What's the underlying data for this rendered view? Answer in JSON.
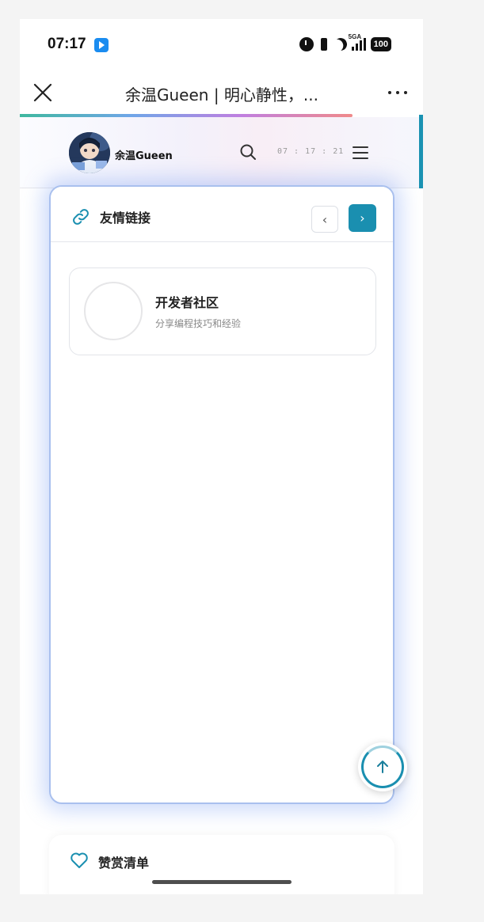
{
  "status_bar": {
    "time": "07:17",
    "signal_label": "5GA",
    "battery": "100"
  },
  "nav": {
    "title": "余温Gueen | 明心静性，..."
  },
  "site_header": {
    "site_name": "余温Gueen",
    "clock": "07 : 17 : 21"
  },
  "friend_links": {
    "title": "友情链接",
    "prev_label": "‹",
    "next_label": "›",
    "items": [
      {
        "name": "开发者社区",
        "description": "分享编程技巧和经验"
      }
    ]
  },
  "donation": {
    "title": "赞赏清单"
  },
  "colors": {
    "accent": "#1a8fb0",
    "card_glow": "#a9c0ee"
  }
}
